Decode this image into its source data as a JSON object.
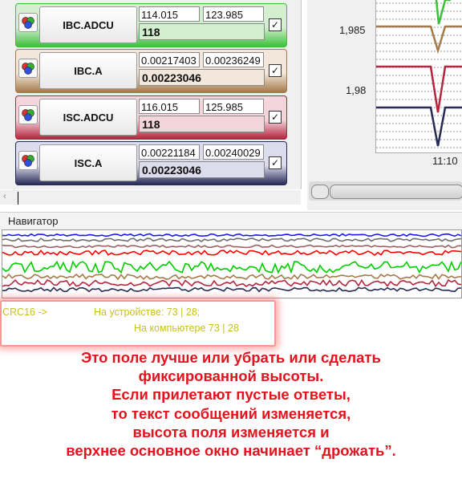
{
  "variables": [
    {
      "name": "IBC.ADCU",
      "min": "114.015",
      "max": "123.985",
      "value": "118",
      "color": "#3cbf3c",
      "light": "#d2f0d0"
    },
    {
      "name": "IBC.A",
      "min": "0.00217403",
      "max": "0.00236249",
      "value": "0.00223046",
      "color": "#a47a4a",
      "light": "#f2e7da"
    },
    {
      "name": "ISC.ADCU",
      "min": "116.015",
      "max": "125.985",
      "value": "118",
      "color": "#b5253e",
      "light": "#f5d5dc"
    },
    {
      "name": "ISC.A",
      "min": "0.00221184",
      "max": "0.00240029",
      "value": "0.00223046",
      "color": "#262a55",
      "light": "#dcdcec"
    }
  ],
  "check_mark": "✓",
  "icons": {
    "variable_icon": "rgb-circles-icon",
    "left_scroll_arrow": "chevron-left-icon",
    "left_scroll_arrow_glyph": "‹"
  },
  "chart": {
    "y_ticks": [
      "1,985",
      "1,98"
    ],
    "x_tick": "11:10",
    "series_colors": [
      "#3cbf3c",
      "#a47a4a",
      "#b5253e",
      "#262a55"
    ]
  },
  "navigator": {
    "label": "Навигатор",
    "line_colors": [
      "#1a1aff",
      "#6e6e6e",
      "#a06060",
      "#ff0000",
      "#00cc00",
      "#a47a4a",
      "#b5253e",
      "#262a55"
    ]
  },
  "log": {
    "crc_label": "CRC16 ->",
    "device_text": "На устройстве: 73 | 28;",
    "computer_text": "На компьютере 73 | 28"
  },
  "annotation": {
    "lines": [
      "Это поле лучше или убрать или сделать",
      "фиксированной высоты.",
      "Если прилетают пустые ответы,",
      "то  текст сообщений изменяется,",
      "высота поля изменяется и",
      "верхнее основное окно начинает “дрожать”."
    ]
  }
}
